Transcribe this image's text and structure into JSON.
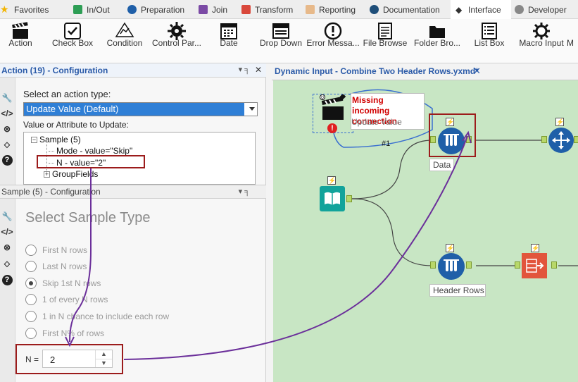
{
  "tabs": [
    {
      "label": "Favorites",
      "color": "#f2b400"
    },
    {
      "label": "In/Out",
      "color": "#2e9e55"
    },
    {
      "label": "Preparation",
      "color": "#1f5fa8"
    },
    {
      "label": "Join",
      "color": "#7b4aa5"
    },
    {
      "label": "Transform",
      "color": "#d9483b"
    },
    {
      "label": "Reporting",
      "color": "#e7b98a"
    },
    {
      "label": "Documentation",
      "color": "#1e4e79"
    },
    {
      "label": "Interface",
      "color": "#222222"
    },
    {
      "label": "Developer",
      "color": "#888888"
    }
  ],
  "tools": [
    {
      "label": "Action",
      "icon": "clapperboard-icon"
    },
    {
      "label": "Check Box",
      "icon": "checkbox-icon"
    },
    {
      "label": "Condition",
      "icon": "condition-icon"
    },
    {
      "label": "Control Par...",
      "icon": "control-parameter-icon"
    },
    {
      "label": "Date",
      "icon": "calendar-icon"
    },
    {
      "label": "Drop Down",
      "icon": "dropdown-icon"
    },
    {
      "label": "Error Messa...",
      "icon": "error-icon"
    },
    {
      "label": "File Browse",
      "icon": "file-browse-icon"
    },
    {
      "label": "Folder Bro...",
      "icon": "folder-icon"
    },
    {
      "label": "List Box",
      "icon": "listbox-icon"
    },
    {
      "label": "Macro Input",
      "icon": "macro-input-icon"
    },
    {
      "label": "M",
      "icon": "macro-output-icon"
    }
  ],
  "action_panel": {
    "title": "Action (19) - Configuration",
    "pin": "▾ ╕",
    "close": "✕",
    "select_label": "Select an action type:",
    "select_value": "Update Value (Default)",
    "value_label": "Value or Attribute to Update:",
    "tree": {
      "root": "Sample (5)",
      "mode": "Mode - value=\"Skip\"",
      "n": "N - value=\"2\"",
      "groupfields": "GroupFields"
    }
  },
  "sample_panel": {
    "title": "Sample (5) - Configuration",
    "pin": "▾ ╕",
    "heading": "Select Sample Type",
    "options": [
      {
        "label": "First N rows",
        "selected": false
      },
      {
        "label": "Last N rows",
        "selected": false
      },
      {
        "label": "Skip 1st N rows",
        "selected": true
      },
      {
        "label": "1 of every N rows",
        "selected": false
      },
      {
        "label": "1 in N chance to include each row",
        "selected": false
      },
      {
        "label": "First N% of rows",
        "selected": false
      }
    ],
    "n_label": "N =",
    "n_value": "2"
  },
  "canvas": {
    "tab_title": "Dynamic Input - Combine Two Header Rows.yxmd*",
    "close": "✕",
    "warning": "Missing incoming connection.",
    "update_value": "Update Value",
    "connection_label": "#1",
    "data_label": "Data",
    "header_rows_label": "Header Rows",
    "background_color": "#c8e6c4",
    "highlight_color": "#9c1c1c",
    "arrow_color": "#6b2f9a"
  }
}
